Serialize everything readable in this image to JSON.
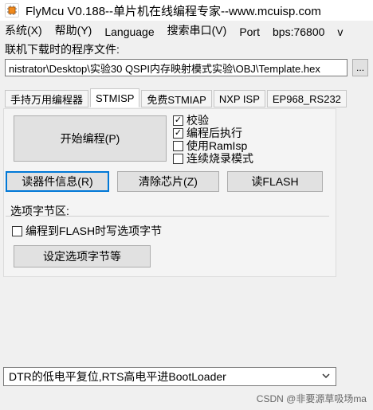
{
  "window": {
    "title": "FlyMcu V0.188--单片机在线编程专家--www.mcuisp.com",
    "icon": "chip-icon"
  },
  "menu": {
    "items": [
      "系统(X)",
      "帮助(Y)",
      "Language",
      "搜索串口(V)",
      "Port",
      "bps:76800",
      "v"
    ]
  },
  "program_file": {
    "label": "联机下载时的程序文件:",
    "path": "nistrator\\Desktop\\实验30 QSPI内存映射模式实验\\OBJ\\Template.hex",
    "browse_label": "..."
  },
  "tabs": [
    "手持万用编程器",
    "STMISP",
    "免费STMIAP",
    "NXP ISP",
    "EP968_RS232"
  ],
  "main": {
    "start_button": "开始编程(P)",
    "checks": [
      {
        "label": "校验",
        "checked": true
      },
      {
        "label": "编程后执行",
        "checked": true
      },
      {
        "label": "使用RamIsp",
        "checked": false
      },
      {
        "label": "连续烧录模式",
        "checked": false
      }
    ],
    "buttons": [
      "读器件信息(R)",
      "清除芯片(Z)",
      "读FLASH"
    ],
    "options": {
      "title": "选项字节区:",
      "check_label": "编程到FLASH时写选项字节",
      "button_label": "设定选项字节等"
    }
  },
  "reset_mode": {
    "selected": "DTR的低电平复位,RTS高电平进BootLoader"
  },
  "watermark": "CSDN @非要源草吸场ma"
}
